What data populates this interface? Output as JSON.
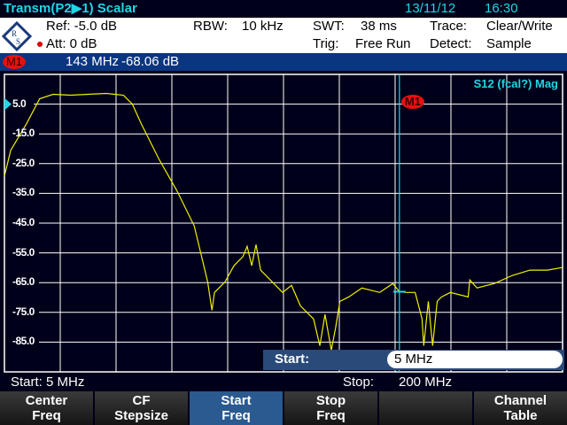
{
  "header": {
    "title": "Transm(P2▶1) Scalar",
    "date": "13/11/12",
    "time": "16:30"
  },
  "info": {
    "ref": "Ref:  -5.0 dB",
    "att": "Att:  0 dB",
    "rbw_label": "RBW:",
    "rbw": "10 kHz",
    "swt_label": "SWT:",
    "swt": "38 ms",
    "trig_label": "Trig:",
    "trig": "Free Run",
    "trace_label": "Trace:",
    "trace": "Clear/Write",
    "detect_label": "Detect:",
    "detect": "Sample"
  },
  "marker": {
    "label": "M1",
    "freq": "143 MHz",
    "value": "-68.06 dB",
    "freq_mhz": 143,
    "value_db": -68.06
  },
  "plot": {
    "measurement": "S12 (fcal?) Mag",
    "y_labels": [
      "5.0",
      "-15.0",
      "-25.0",
      "-35.0",
      "-45.0",
      "-55.0",
      "-65.0",
      "-75.0",
      "-85.0"
    ]
  },
  "chart_data": {
    "type": "line",
    "xlim": [
      5,
      200
    ],
    "ylim": [
      -95,
      5
    ],
    "x_unit": "MHz",
    "y_unit": "dB",
    "ref_level": -5,
    "series": [
      {
        "name": "Trace",
        "color": "#f0f000",
        "x": [
          5,
          7.2,
          12.7,
          17.3,
          22.0,
          28.1,
          40.5,
          46.6,
          49.7,
          52.8,
          59.0,
          65.2,
          71.3,
          76.0,
          77.5,
          78.4,
          82.1,
          85.2,
          88.3,
          89.8,
          91.4,
          92.9,
          94.5,
          97.6,
          102.2,
          105.3,
          108.4,
          113.0,
          115.2,
          117.0,
          119.2,
          120.7,
          122.2,
          125.3,
          129.9,
          136.1,
          140.7,
          143,
          145.4,
          148.5,
          150.9,
          151.5,
          153.1,
          154.6,
          156.2,
          157.7,
          160.8,
          167.0,
          167.6,
          170.1,
          176.2,
          182.4,
          188.6,
          194.7,
          200
        ],
        "y": [
          -29.2,
          -20.5,
          -11.6,
          -3.2,
          -1.7,
          -2.0,
          -1.4,
          -2.0,
          -5.0,
          -11.6,
          -23.5,
          -34.0,
          -45.9,
          -64.7,
          -74.3,
          -68.3,
          -64.7,
          -59.3,
          -56.3,
          -52.8,
          -59.3,
          -52.2,
          -60.8,
          -63.8,
          -68.3,
          -65.9,
          -72.8,
          -77.2,
          -86.2,
          -75.7,
          -87.7,
          -80.2,
          -71.3,
          -69.8,
          -66.8,
          -68.3,
          -65.3,
          -68.06,
          -68.3,
          -68.3,
          -77.2,
          -86.2,
          -71.3,
          -86.2,
          -71.3,
          -69.8,
          -68.3,
          -69.8,
          -64.1,
          -66.8,
          -65.3,
          -62.6,
          -60.8,
          -60.8,
          -59.9
        ]
      }
    ]
  },
  "entry": {
    "label": "Start:",
    "value": "5 MHz"
  },
  "footer": {
    "start": "Start:  5 MHz",
    "stop_label": "Stop:",
    "stop": "200 MHz"
  },
  "softkeys": [
    {
      "l1": "Center",
      "l2": "Freq"
    },
    {
      "l1": "CF",
      "l2": "Stepsize"
    },
    {
      "l1": "Start",
      "l2": "Freq"
    },
    {
      "l1": "Stop",
      "l2": "Freq"
    },
    {
      "l1": "",
      "l2": ""
    },
    {
      "l1": "Channel",
      "l2": "Table"
    }
  ],
  "colors": {
    "title": "#1fd6e6",
    "marker_bar": "#0a3580",
    "trace": "#f0f000",
    "marker_line": "#1fd6e6",
    "active_key": "#2a5a90"
  }
}
